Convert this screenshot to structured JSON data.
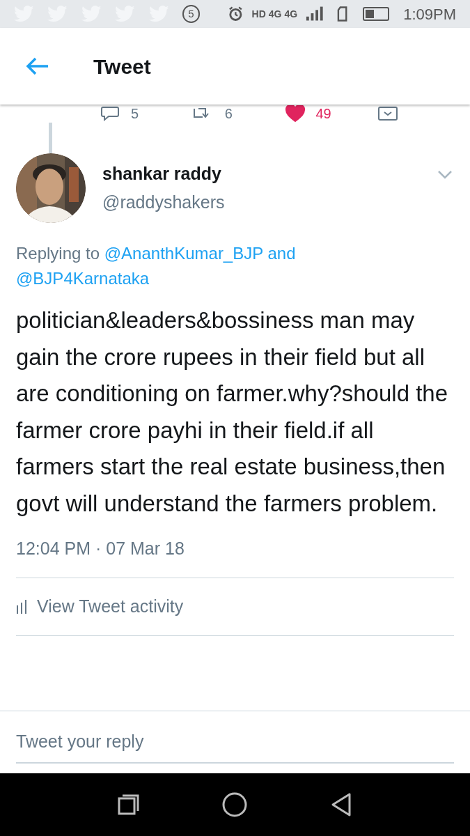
{
  "status_bar": {
    "notification_count": "5",
    "network_labels": [
      "HD",
      "4G",
      "4G"
    ],
    "time": "1:09PM"
  },
  "header": {
    "title": "Tweet"
  },
  "parent_actions": [
    {
      "kind": "reply",
      "count": "5",
      "liked": false
    },
    {
      "kind": "retweet",
      "count": "6",
      "liked": false
    },
    {
      "kind": "like",
      "count": "49",
      "liked": true
    },
    {
      "kind": "share",
      "liked": false
    }
  ],
  "tweet": {
    "author": {
      "name": "shankar raddy",
      "handle": "@raddyshakers"
    },
    "replying": {
      "prefix": "Replying to",
      "mentions": [
        "@AnanthKumar_BJP",
        "@BJP4Karnataka"
      ],
      "joiner": "and"
    },
    "text": "politician&leaders&bossiness man may gain the crore rupees in their field but all are conditioning on farmer.why?should the farmer crore payhi in their field.if all farmers start the real estate business,then govt will understand the farmers problem.",
    "timestamp": "12:04 PM · 07 Mar 18",
    "activity_link": "View Tweet activity"
  },
  "reply_bar": {
    "placeholder": "Tweet your reply"
  }
}
